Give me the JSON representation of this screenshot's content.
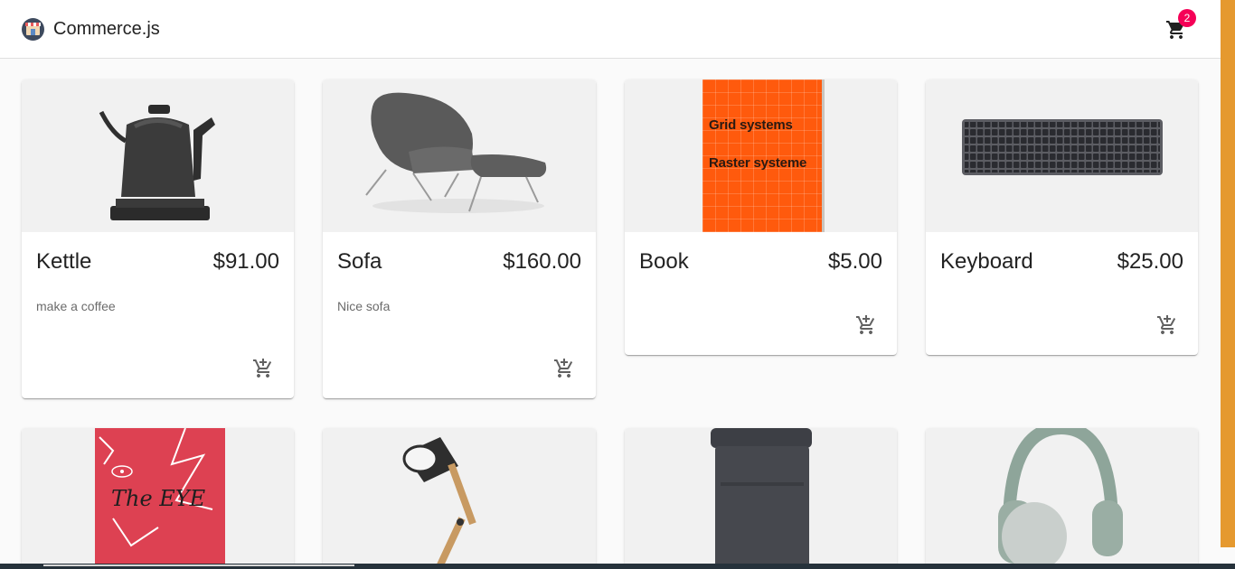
{
  "app": {
    "title": "Commerce.js",
    "logo_icon": "shop-icon",
    "cart_count": "2",
    "cart_icon": "shopping-cart-icon"
  },
  "products": [
    {
      "name": "Kettle",
      "price": "$91.00",
      "description": "make a coffee",
      "image": "kettle"
    },
    {
      "name": "Sofa",
      "price": "$160.00",
      "description": "Nice sofa",
      "image": "lounge-chair"
    },
    {
      "name": "Book",
      "price": "$5.00",
      "description": "",
      "image": "book-cover",
      "cover_lines": [
        "Grid systems",
        "Raster systeme"
      ]
    },
    {
      "name": "Keyboard",
      "price": "$25.00",
      "description": "",
      "image": "keyboard"
    },
    {
      "name": "",
      "price": "",
      "description": "",
      "image": "book-cover",
      "cover_lines": [
        "The EYE"
      ]
    },
    {
      "name": "",
      "price": "",
      "description": "",
      "image": "desk-lamp"
    },
    {
      "name": "",
      "price": "",
      "description": "",
      "image": "backpack"
    },
    {
      "name": "",
      "price": "",
      "description": "",
      "image": "headphones"
    }
  ],
  "colors": {
    "accent": "#f50057",
    "cover_orange": "#ff5a0d",
    "cover_red": "#dd4152",
    "side_strip": "#e5992f"
  },
  "add_to_cart_icon": "add-shopping-cart-icon"
}
